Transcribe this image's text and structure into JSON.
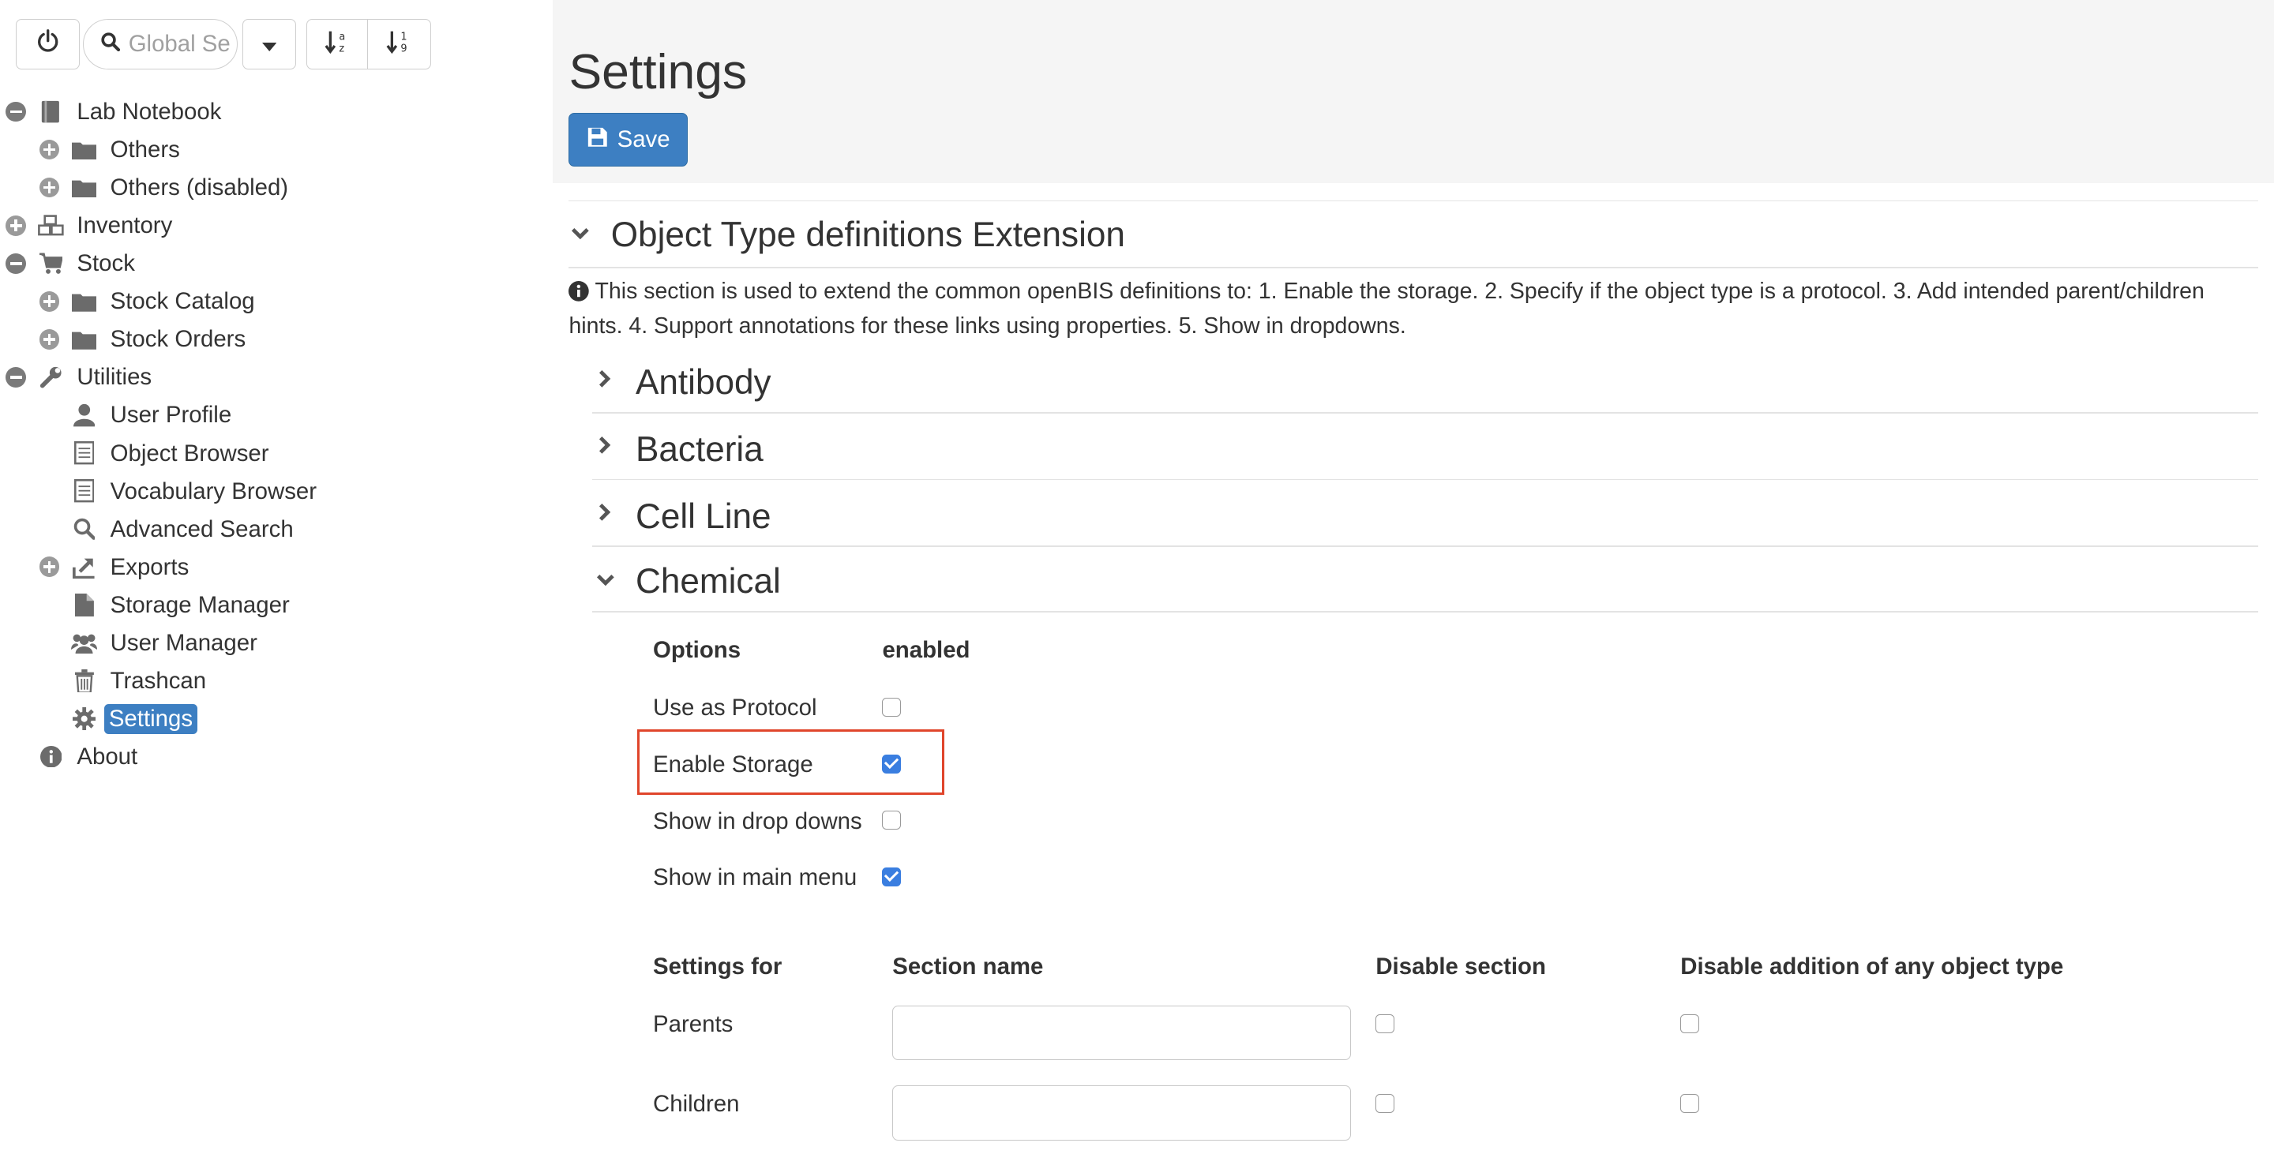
{
  "toolbar": {
    "search_placeholder": "Global Search"
  },
  "tree": {
    "items": [
      {
        "label": "Lab Notebook",
        "icon": "notebook-icon",
        "expander": "minus"
      },
      {
        "label": "Others",
        "icon": "folder-icon",
        "expander": "plus"
      },
      {
        "label": "Others (disabled)",
        "icon": "folder-icon",
        "expander": "plus"
      },
      {
        "label": "Inventory",
        "icon": "cubes-icon",
        "expander": "plus"
      },
      {
        "label": "Stock",
        "icon": "cart-icon",
        "expander": "minus"
      },
      {
        "label": "Stock Catalog",
        "icon": "folder-icon",
        "expander": "plus"
      },
      {
        "label": "Stock Orders",
        "icon": "folder-icon",
        "expander": "plus"
      },
      {
        "label": "Utilities",
        "icon": "wrench-icon",
        "expander": "minus"
      },
      {
        "label": "User Profile",
        "icon": "user-icon",
        "expander": "none"
      },
      {
        "label": "Object Browser",
        "icon": "list-icon",
        "expander": "none"
      },
      {
        "label": "Vocabulary Browser",
        "icon": "list-icon",
        "expander": "none"
      },
      {
        "label": "Advanced Search",
        "icon": "search-icon",
        "expander": "none"
      },
      {
        "label": "Exports",
        "icon": "export-icon",
        "expander": "plus"
      },
      {
        "label": "Storage Manager",
        "icon": "file-icon",
        "expander": "none"
      },
      {
        "label": "User Manager",
        "icon": "users-icon",
        "expander": "none"
      },
      {
        "label": "Trashcan",
        "icon": "trash-icon",
        "expander": "none"
      },
      {
        "label": "Settings",
        "icon": "gear-icon",
        "expander": "none",
        "selected": true
      },
      {
        "label": "About",
        "icon": "info-icon",
        "expander": "none"
      }
    ]
  },
  "main": {
    "title": "Settings",
    "save_label": "Save",
    "section_title": "Object Type definitions Extension",
    "info": "This section is used to extend the common openBIS definitions to: 1. Enable the storage. 2. Specify if the object type is a protocol. 3. Add intended parent/children hints. 4. Support annotations for these links using properties. 5. Show in dropdowns.",
    "types": [
      {
        "label": "Antibody",
        "expanded": false
      },
      {
        "label": "Bacteria",
        "expanded": false
      },
      {
        "label": "Cell Line",
        "expanded": false
      },
      {
        "label": "Chemical",
        "expanded": true
      }
    ],
    "options": {
      "header_options": "Options",
      "header_enabled": "enabled",
      "rows": [
        {
          "label": "Use as Protocol",
          "checked": false
        },
        {
          "label": "Enable Storage",
          "checked": true
        },
        {
          "label": "Show in drop downs",
          "checked": false
        },
        {
          "label": "Show in main menu",
          "checked": true
        }
      ]
    },
    "links": {
      "headers": [
        "Settings for",
        "Section name",
        "Disable section",
        "Disable addition of any object type"
      ],
      "rows": [
        {
          "label": "Parents",
          "section_name": "",
          "disable_section": false,
          "disable_addition": false
        },
        {
          "label": "Children",
          "section_name": "",
          "disable_section": false,
          "disable_addition": false
        }
      ]
    }
  },
  "colors": {
    "accent": "#3d7fc2",
    "highlight": "#e0452b",
    "checkbox_checked": "#3a7ee0"
  }
}
